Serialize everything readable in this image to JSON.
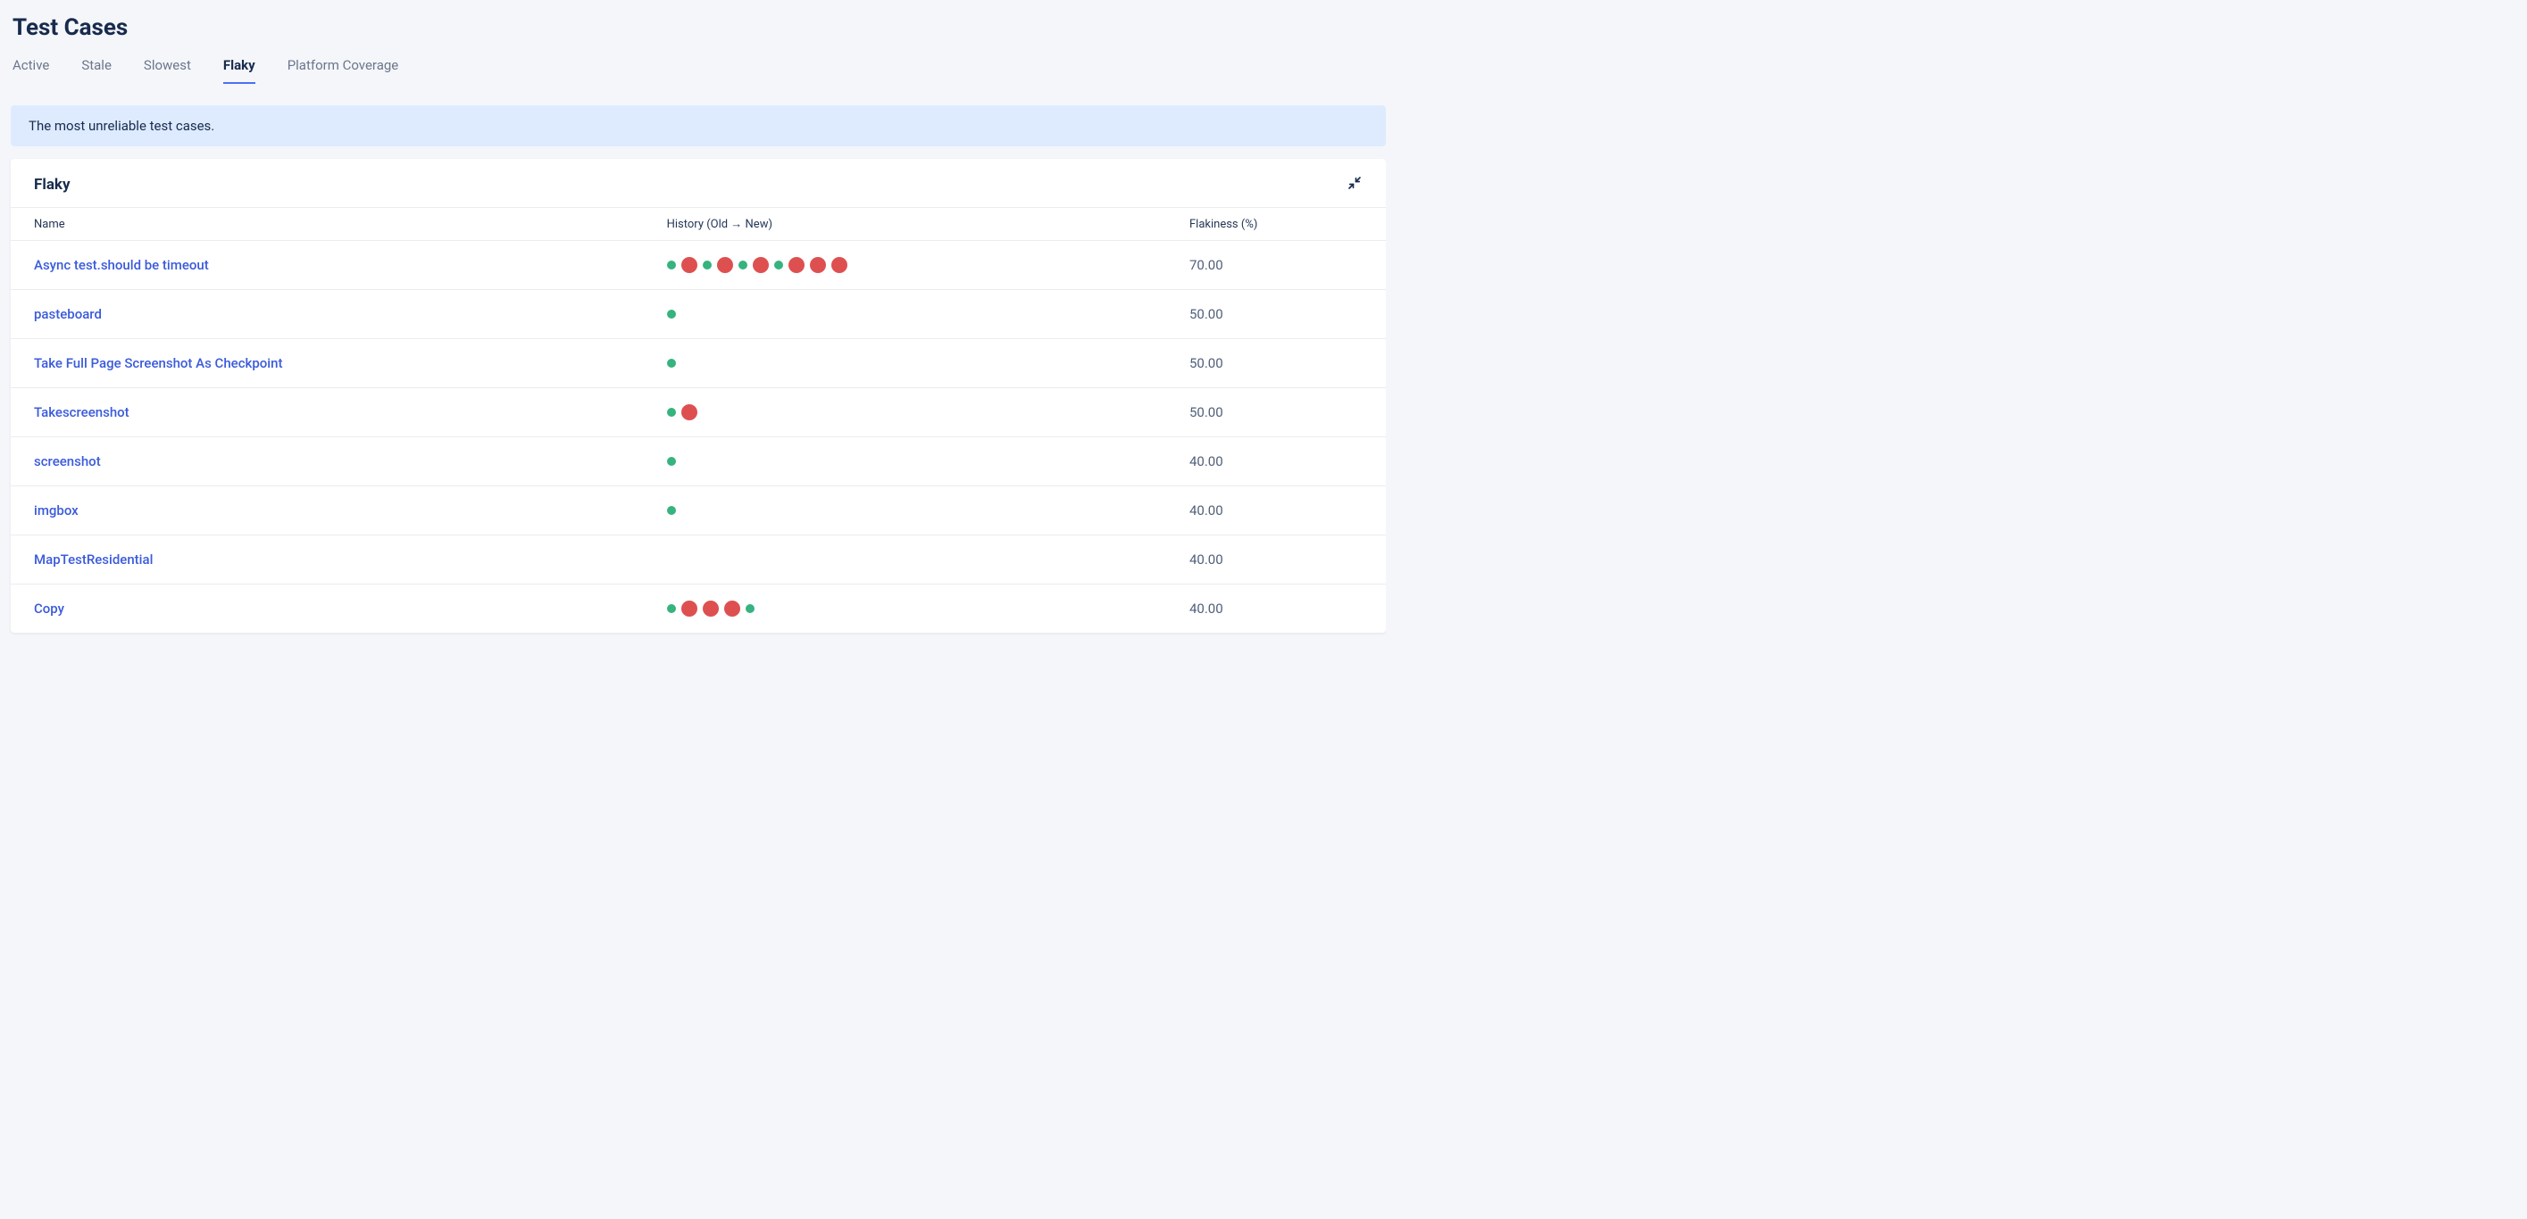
{
  "page": {
    "title": "Test Cases"
  },
  "tabs": [
    {
      "label": "Active",
      "active": false
    },
    {
      "label": "Stale",
      "active": false
    },
    {
      "label": "Slowest",
      "active": false
    },
    {
      "label": "Flaky",
      "active": true
    },
    {
      "label": "Platform Coverage",
      "active": false
    }
  ],
  "banner": {
    "text": "The most unreliable test cases."
  },
  "card": {
    "title": "Flaky"
  },
  "columns": {
    "name": "Name",
    "history": "History (Old → New)",
    "flakiness": "Flakiness (%)"
  },
  "rows": [
    {
      "name": "Async test.should be timeout",
      "history": [
        "pass",
        "fail",
        "pass",
        "fail",
        "pass",
        "fail",
        "pass",
        "fail",
        "fail",
        "fail"
      ],
      "flakiness": "70.00"
    },
    {
      "name": "pasteboard",
      "history": [
        "pass"
      ],
      "flakiness": "50.00"
    },
    {
      "name": "Take Full Page Screenshot As Checkpoint",
      "history": [
        "pass"
      ],
      "flakiness": "50.00"
    },
    {
      "name": "Takescreenshot",
      "history": [
        "pass",
        "fail"
      ],
      "flakiness": "50.00"
    },
    {
      "name": "screenshot",
      "history": [
        "pass"
      ],
      "flakiness": "40.00"
    },
    {
      "name": "imgbox",
      "history": [
        "pass"
      ],
      "flakiness": "40.00"
    },
    {
      "name": "MapTestResidential",
      "history": [],
      "flakiness": "40.00"
    },
    {
      "name": "Copy",
      "history": [
        "pass",
        "fail",
        "fail",
        "fail",
        "pass"
      ],
      "flakiness": "40.00"
    }
  ]
}
